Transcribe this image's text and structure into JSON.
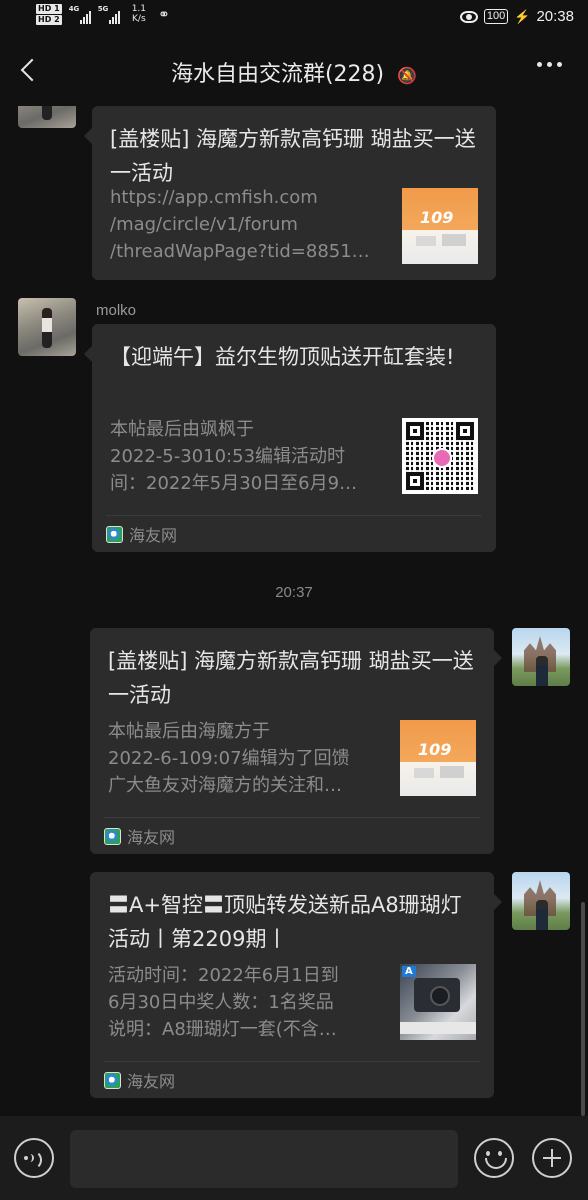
{
  "status_bar": {
    "hd1": "HD 1",
    "hd2": "HD 2",
    "net1": "4G",
    "net2": "5G",
    "speed_value": "1.1",
    "speed_unit": "K/s",
    "battery": "100",
    "time": "20:38"
  },
  "header": {
    "title": "海水自由交流群(228)",
    "mute_icon": "bell-muted-icon",
    "more_icon": "more-dots-icon"
  },
  "messages": [
    {
      "title": "[盖楼贴] 海魔方新款高钙珊 瑚盐买一送一活动",
      "desc_lines": [
        "https://app.cmfish.com",
        "/mag/circle/v1/forum",
        "/threadWapPage?tid=8851…"
      ],
      "thumb_text": "109"
    },
    {
      "sender": "molko",
      "title": "【迎端午】益尔生物顶贴送开缸套装!",
      "desc_lines": [
        "本帖最后由飒枫于",
        "2022-5-3010:53编辑活动时",
        "间：2022年5月30日至6月9…"
      ],
      "source": "海友网"
    },
    {
      "timestamp": "20:37"
    },
    {
      "title": "[盖楼贴] 海魔方新款高钙珊 瑚盐买一送一活动",
      "desc_lines": [
        "本帖最后由海魔方于",
        "2022-6-109:07编辑为了回馈",
        "广大鱼友对海魔方的关注和…"
      ],
      "thumb_text": "109",
      "source": "海友网"
    },
    {
      "title": "〓A+智控〓顶贴转发送新品A8珊瑚灯活动丨第2209期丨",
      "desc_lines": [
        "活动时间：2022年6月1日到",
        "6月30日中奖人数：1名奖品",
        "说明：A8珊瑚灯一套(不含…"
      ],
      "thumb_badge": "A",
      "source": "海友网"
    }
  ],
  "input_bar": {
    "placeholder": "",
    "voice_icon": "voice-icon",
    "emoji_icon": "emoji-icon",
    "plus_icon": "plus-icon"
  },
  "colors": {
    "background": "#111111",
    "bubble": "#2c2c2c",
    "title_text": "#e6e6e6",
    "desc_text": "#8c8c8c"
  }
}
